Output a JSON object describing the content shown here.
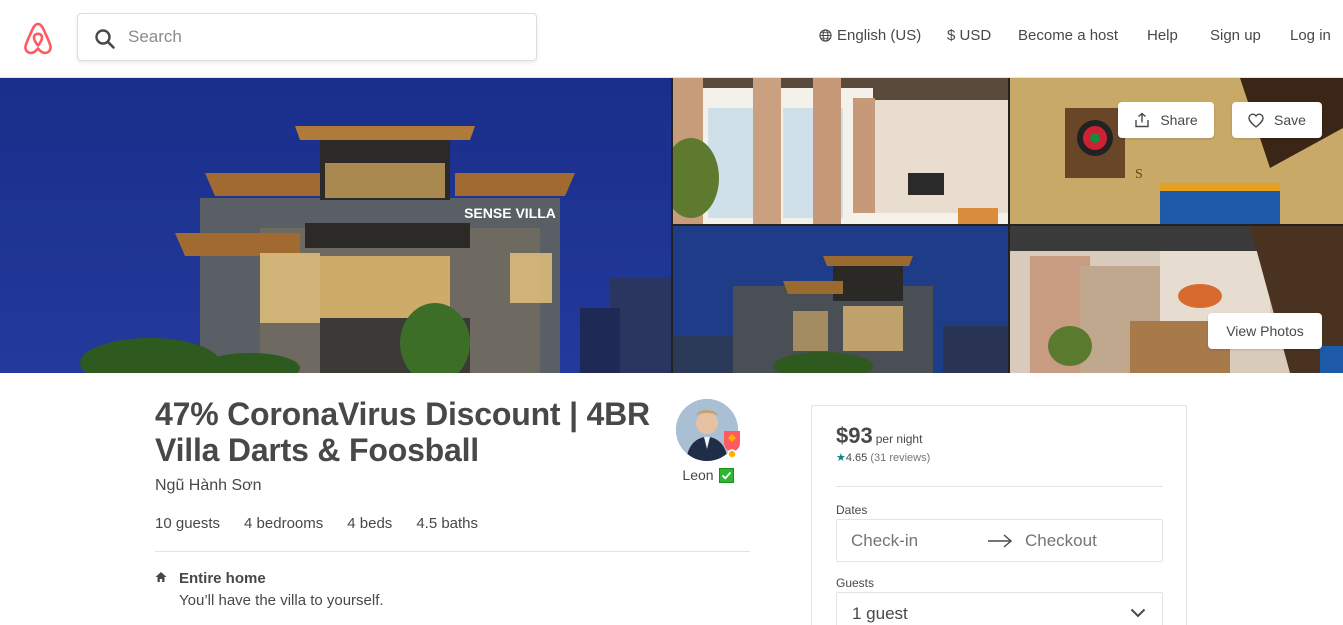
{
  "header": {
    "search_placeholder": "Search",
    "nav": {
      "language": "English (US)",
      "currency": "$ USD",
      "become_host": "Become a host",
      "help": "Help",
      "sign_up": "Sign up",
      "log_in": "Log in"
    },
    "brand_color": "#FF5A5F"
  },
  "photos": {
    "sign_text": "SENSE VILLA",
    "share_label": "Share",
    "save_label": "Save",
    "view_photos_label": "View Photos"
  },
  "listing": {
    "title": "47% CoronaVirus Discount | 4BR Villa Darts & Foosball",
    "location": "Ngũ Hành Sơn",
    "host_name": "Leon",
    "specs": {
      "guests": "10 guests",
      "bedrooms": "4 bedrooms",
      "beds": "4 beds",
      "baths": "4.5 baths"
    },
    "feature": {
      "title": "Entire home",
      "description": "You’ll have the villa to yourself."
    }
  },
  "booking": {
    "price": "$93",
    "per_night": "per night",
    "rating_star": "★",
    "rating": "4.65",
    "reviews": "(31 reviews)",
    "dates_label": "Dates",
    "check_in": "Check-in",
    "checkout": "Checkout",
    "guests_label": "Guests",
    "guests_value": "1 guest",
    "accent_color": "#008489"
  }
}
